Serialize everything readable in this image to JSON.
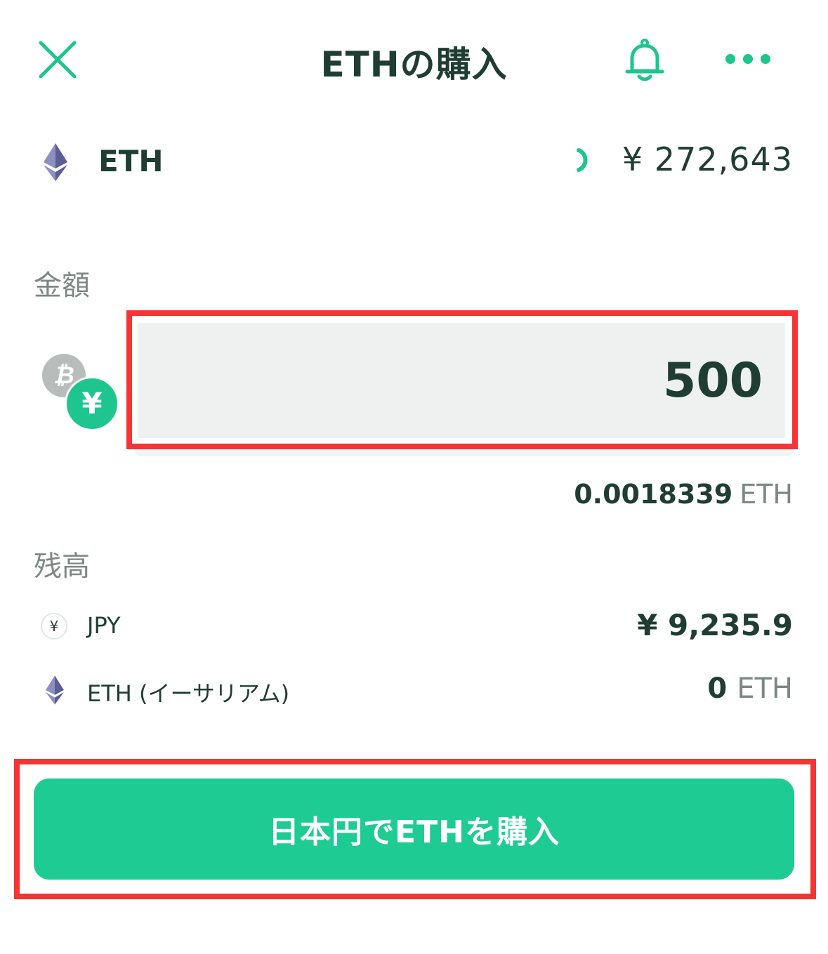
{
  "header": {
    "title": "ETHの購入",
    "close_icon": "close-icon",
    "bell_icon": "bell-icon",
    "more_icon": "more-icon"
  },
  "asset": {
    "symbol": "ETH",
    "price": "¥ 272,643",
    "icon": "ethereum-icon"
  },
  "amount": {
    "label": "金額",
    "value": "500",
    "btc_glyph": "₿",
    "yen_glyph": "¥",
    "converted_value": "0.0018339",
    "converted_unit": "ETH"
  },
  "balance": {
    "label": "残高",
    "items": [
      {
        "icon_glyph": "¥",
        "name": "JPY",
        "value": "¥ 9,235.9"
      },
      {
        "icon": "ethereum-icon",
        "name": "ETH (イーサリアム)",
        "value": "0",
        "unit": "ETH"
      }
    ]
  },
  "buy_button": {
    "label": "日本円でETHを購入"
  },
  "colors": {
    "accent": "#1ecb93",
    "text_dark": "#1f3d33",
    "text_muted": "#7d8784",
    "highlight": "#f53434",
    "field_bg": "#eef1f0"
  }
}
